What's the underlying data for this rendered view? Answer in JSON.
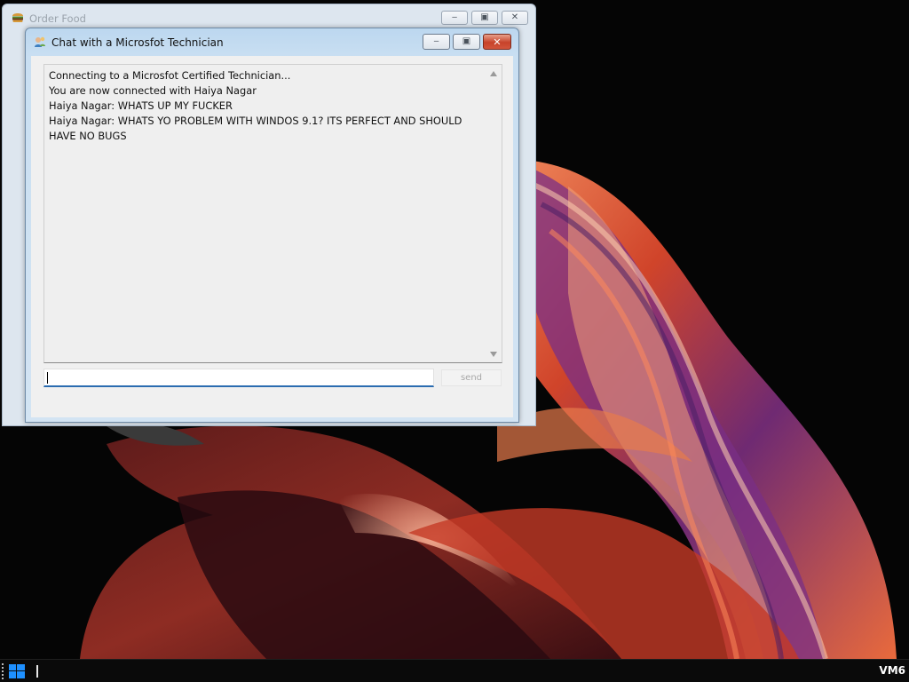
{
  "back_window": {
    "title": "Order Food",
    "icon": "burger-icon",
    "buttons": [
      "minimize",
      "maximize",
      "close"
    ]
  },
  "chat_window": {
    "title": "Chat with a Microsfot Technician",
    "icon": "technician-icon",
    "messages": [
      "Connecting to a Microsfot Certified Technician...",
      "You are now connected with Haiya Nagar",
      "Haiya Nagar: WHATS UP MY FUCKER",
      "Haiya Nagar: WHATS YO PROBLEM WITH WINDOS 9.1? ITS PERFECT AND SHOULD HAVE NO BUGS"
    ],
    "input": {
      "value": "",
      "placeholder": ""
    },
    "send_label": "send"
  },
  "taskbar": {
    "start_icon": "windows-logo-icon",
    "vm_label": "VM6"
  },
  "colors": {
    "desktop": "#050505",
    "wallpaper_accent": "#e0562a",
    "close_button": "#c7432a",
    "input_focus": "#2b6cb0"
  }
}
